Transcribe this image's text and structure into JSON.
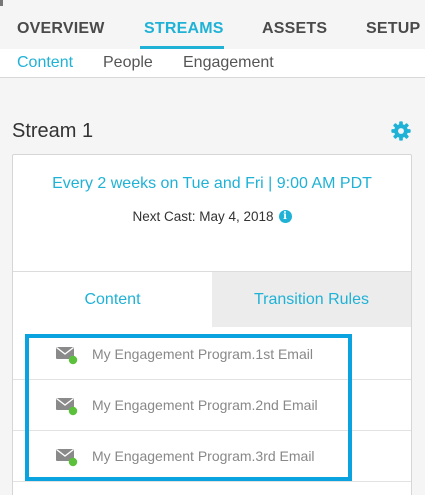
{
  "main_tabs": [
    {
      "label": "OVERVIEW"
    },
    {
      "label": "STREAMS"
    },
    {
      "label": "ASSETS"
    },
    {
      "label": "SETUP"
    }
  ],
  "active_main_tab": "STREAMS",
  "sub_tabs": [
    {
      "label": "Content"
    },
    {
      "label": "People"
    },
    {
      "label": "Engagement"
    }
  ],
  "active_sub_tab": "Content",
  "stream": {
    "title": "Stream 1",
    "settings_icon": "gear-icon",
    "schedule": "Every 2 weeks on Tue and Fri | 9:00 AM PDT",
    "next_cast_label": "Next Cast:",
    "next_cast_date": "May 4, 2018",
    "info_icon": "info-icon"
  },
  "card_tabs": [
    {
      "label": "Content"
    },
    {
      "label": "Transition Rules"
    }
  ],
  "emails": [
    {
      "name": "My Engagement Program.1st Email",
      "icon": "email-icon",
      "status_color": "#5cc13a"
    },
    {
      "name": "My Engagement Program.2nd Email",
      "icon": "email-icon",
      "status_color": "#5cc13a"
    },
    {
      "name": "My Engagement Program.3rd Email",
      "icon": "email-icon",
      "status_color": "#5cc13a"
    }
  ],
  "colors": {
    "accent": "#1fb2d6",
    "highlight": "#0aa3e0",
    "status_active": "#5cc13a"
  }
}
